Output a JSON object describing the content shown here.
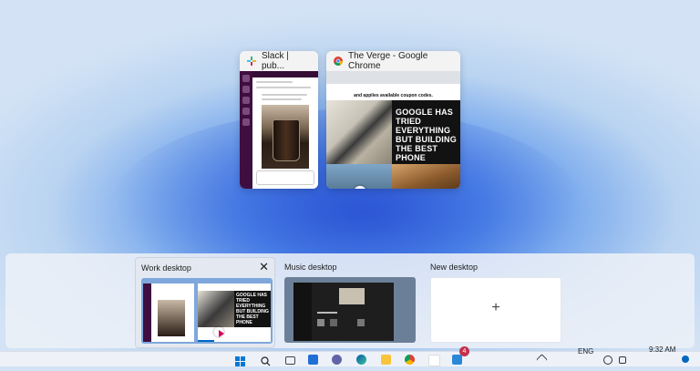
{
  "windows": [
    {
      "title": "Slack | pub...",
      "icon": "slack-icon"
    },
    {
      "title": "The Verge - Google Chrome",
      "icon": "chrome-icon",
      "content": {
        "ad_text": "and applies available coupon codes.",
        "headline": "GOOGLE HAS TRIED EVERYTHING BUT BUILDING THE BEST PHONE"
      }
    }
  ],
  "desktops": [
    {
      "label": "Work desktop",
      "active": true
    },
    {
      "label": "Music desktop",
      "active": false
    },
    {
      "label": "New desktop",
      "add_symbol": "+"
    }
  ],
  "taskbar": {
    "language": "ENG",
    "time": "9:32 AM",
    "badge_count": "4",
    "icons": [
      "windows-start-icon",
      "search-icon",
      "task-view-icon",
      "widgets-icon",
      "teams-icon",
      "edge-icon",
      "file-explorer-icon",
      "chrome-icon",
      "slack-icon"
    ]
  },
  "colors": {
    "accent": "#0067c0",
    "slack": "#3f0e40"
  }
}
